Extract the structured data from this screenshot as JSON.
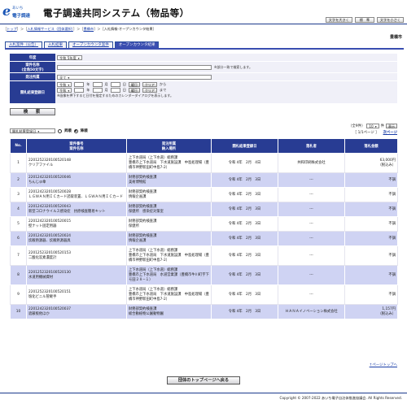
{
  "header": {
    "logo_small": "あいち",
    "logo_name": "電子調達",
    "title": "電子調達共同システム（物品等）",
    "font_buttons": [
      "文字を大きく",
      "標　準",
      "文字を小さく"
    ]
  },
  "breadcrumb": [
    "トップ",
    "入札情報サービス（団体選択）",
    "豊橋市",
    "入札情報-オープンカウンタ結果"
  ],
  "city": "豊橋市",
  "tabs": [
    "入札案件（公告）",
    "入札結果",
    "オープンカウンタ案件",
    "オープンカウンタ結果"
  ],
  "search": {
    "year_label": "年度",
    "year_value": "令和 5年度",
    "case_label": "案件名称\n(全角50文字)",
    "case_note": "※部分一致で検索します。",
    "dept_label": "発注所属",
    "dept_value": "全て",
    "date_label": "開札結果登録日",
    "date_from": {
      "era": "令和",
      "y_unit": "年",
      "m_unit": "月",
      "d_unit": "日",
      "cal": "曜日",
      "clear": "クリア",
      "suffix": "から"
    },
    "date_to": {
      "era": "令和",
      "y_unit": "年",
      "m_unit": "月",
      "d_unit": "日",
      "cal": "曜日",
      "clear": "クリア",
      "suffix": "まで"
    },
    "date_note": "※画像を押下すると日付を指定するためのカレンダーダイアログを表示します。",
    "search_button": "検　索"
  },
  "sort": {
    "select_value": "開札結果登録日",
    "asc": "昇順",
    "desc": "降順"
  },
  "pager": {
    "total": "（全9件）",
    "per_page": "10",
    "per_page_unit": "件",
    "show_button": "表示",
    "page_info": "［ 1/1ページ ］",
    "next": "次ページ"
  },
  "table": {
    "headers": [
      "No.",
      "案件番号\n案件名称",
      "発注所属\n納入場所",
      "開札結果登録日",
      "落札者",
      "落札金額"
    ],
    "rows": [
      {
        "no": "1",
        "num": "2201252320100520148",
        "name": "クリアファイル",
        "dept": "上下水道局（上下水道）総務課",
        "place": "豊橋市上下水道局　下水道施設課　中島処理場（豊橋市神野新田町中島7-2）",
        "date": "令和 4年　2月　4日",
        "winner": "共和印刷株式会社",
        "amount": "63,000円",
        "tax": "（税込み）"
      },
      {
        "no": "2",
        "num": "2201242320100520046",
        "name": "ちんじゅ傘",
        "dept": "財務部契約検査課",
        "place": "美術博物館",
        "date": "令和 4年　2月　3日",
        "winner": "---",
        "amount": "不調",
        "tax": ""
      },
      {
        "no": "3",
        "num": "2201242320100520028",
        "name": "ＬＧＷＡＮ用ＩＣカード読取装置、ＬＧＷＡＮ用ＩＣカード",
        "dept": "財務部契約検査課",
        "place": "情報企画課",
        "date": "令和 4年　2月　3日",
        "winner": "---",
        "amount": "不調",
        "tax": ""
      },
      {
        "no": "4",
        "num": "2201242320100520043",
        "name": "新型コロナウイルス感染症　抗原検査簡易キット",
        "dept": "財務部契約検査課",
        "place": "保健所　感染症対策室",
        "date": "令和 4年　2月　3日",
        "winner": "---",
        "amount": "不調",
        "tax": ""
      },
      {
        "no": "5",
        "num": "2201242320100520015",
        "name": "壁ナット固定用器",
        "dept": "財務部契約検査課",
        "place": "保健所",
        "date": "令和 4年　2月　3日",
        "winner": "---",
        "amount": "不調",
        "tax": ""
      },
      {
        "no": "6",
        "num": "2201242320100520024",
        "name": "炊飯熱源器、炊飯熱源器具",
        "dept": "財務部契約検査課",
        "place": "情報企画課",
        "date": "令和 4年　2月　3日",
        "winner": "---",
        "amount": "不調",
        "tax": ""
      },
      {
        "no": "7",
        "num": "2201252320100520153",
        "name": "二酸化炭素濃度計",
        "dept": "上下水道局（上下水道）総務課",
        "place": "豊橋市上下水道局　下水道施設課　中島処理場（豊橋市神野新田町中島7-2）",
        "date": "令和 4年　2月　3日",
        "winner": "---",
        "amount": "不調",
        "tax": ""
      },
      {
        "no": "8",
        "num": "2201252320100520130",
        "name": "水道用機械資材",
        "dept": "上下水道局（上下水道）総務課",
        "place": "豊橋市上下水道局　水道営業課（豊橋市牛川町字下モ田２８−１）",
        "date": "令和 4年　2月　3日",
        "winner": "---",
        "amount": "不調",
        "tax": ""
      },
      {
        "no": "9",
        "num": "2201252320100520151",
        "name": "塩化ビニル管継手",
        "dept": "上下水道局（上下水道）総務課",
        "place": "豊橋市上下水道局　下水道施設課　中島処理場（豊橋市神野新田町中島7-2）",
        "date": "令和 4年　2月　3日",
        "winner": "---",
        "amount": "不調",
        "tax": ""
      },
      {
        "no": "10",
        "num": "2201242320100520037",
        "name": "遮蔽板他ほか",
        "dept": "財務部契約検査課",
        "place": "総合動植物公園動物園",
        "date": "令和 4年　2月　3日",
        "winner": "ＨＡＮＡイノベーション株式会社",
        "amount": "1,157円",
        "tax": "（税込み）"
      }
    ]
  },
  "back_button": "団体のトップページへ戻る",
  "page_top": "↑ページトップへ",
  "copyright": "Copyright © 2007-2022 あいち電子自治体推進協議会. All Rights Reserved."
}
